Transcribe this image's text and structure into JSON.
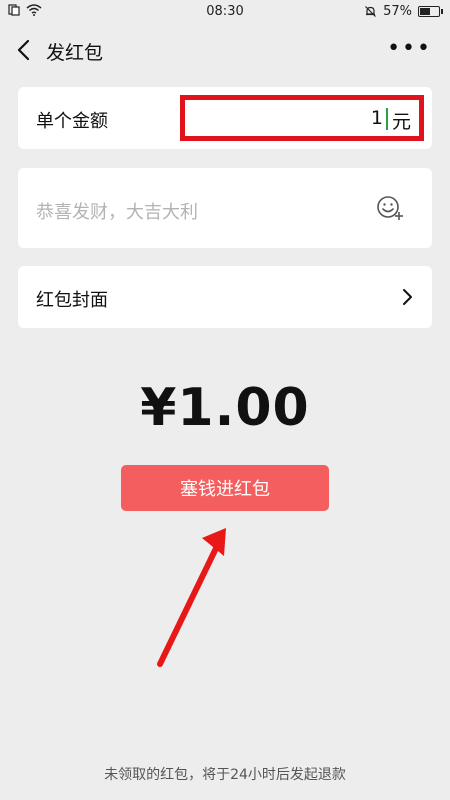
{
  "status_bar": {
    "time": "08:30",
    "battery": "57%",
    "battery_level": 0.57,
    "icons": [
      "sim-icon",
      "wifi-icon",
      "mute-bell-icon",
      "battery-icon"
    ]
  },
  "nav": {
    "title": "发红包",
    "more": "•••"
  },
  "amount": {
    "label": "单个金额",
    "value": "1",
    "unit": "元"
  },
  "greeting": {
    "placeholder": "恭喜发财，大吉大利"
  },
  "cover": {
    "label": "红包封面"
  },
  "total": "¥1.00",
  "send_button": "塞钱进红包",
  "footer_note": "未领取的红包，将于24小时后发起退款",
  "colors": {
    "background": "#ededed",
    "button": "#f45e5e",
    "highlight": "#e0121b"
  }
}
